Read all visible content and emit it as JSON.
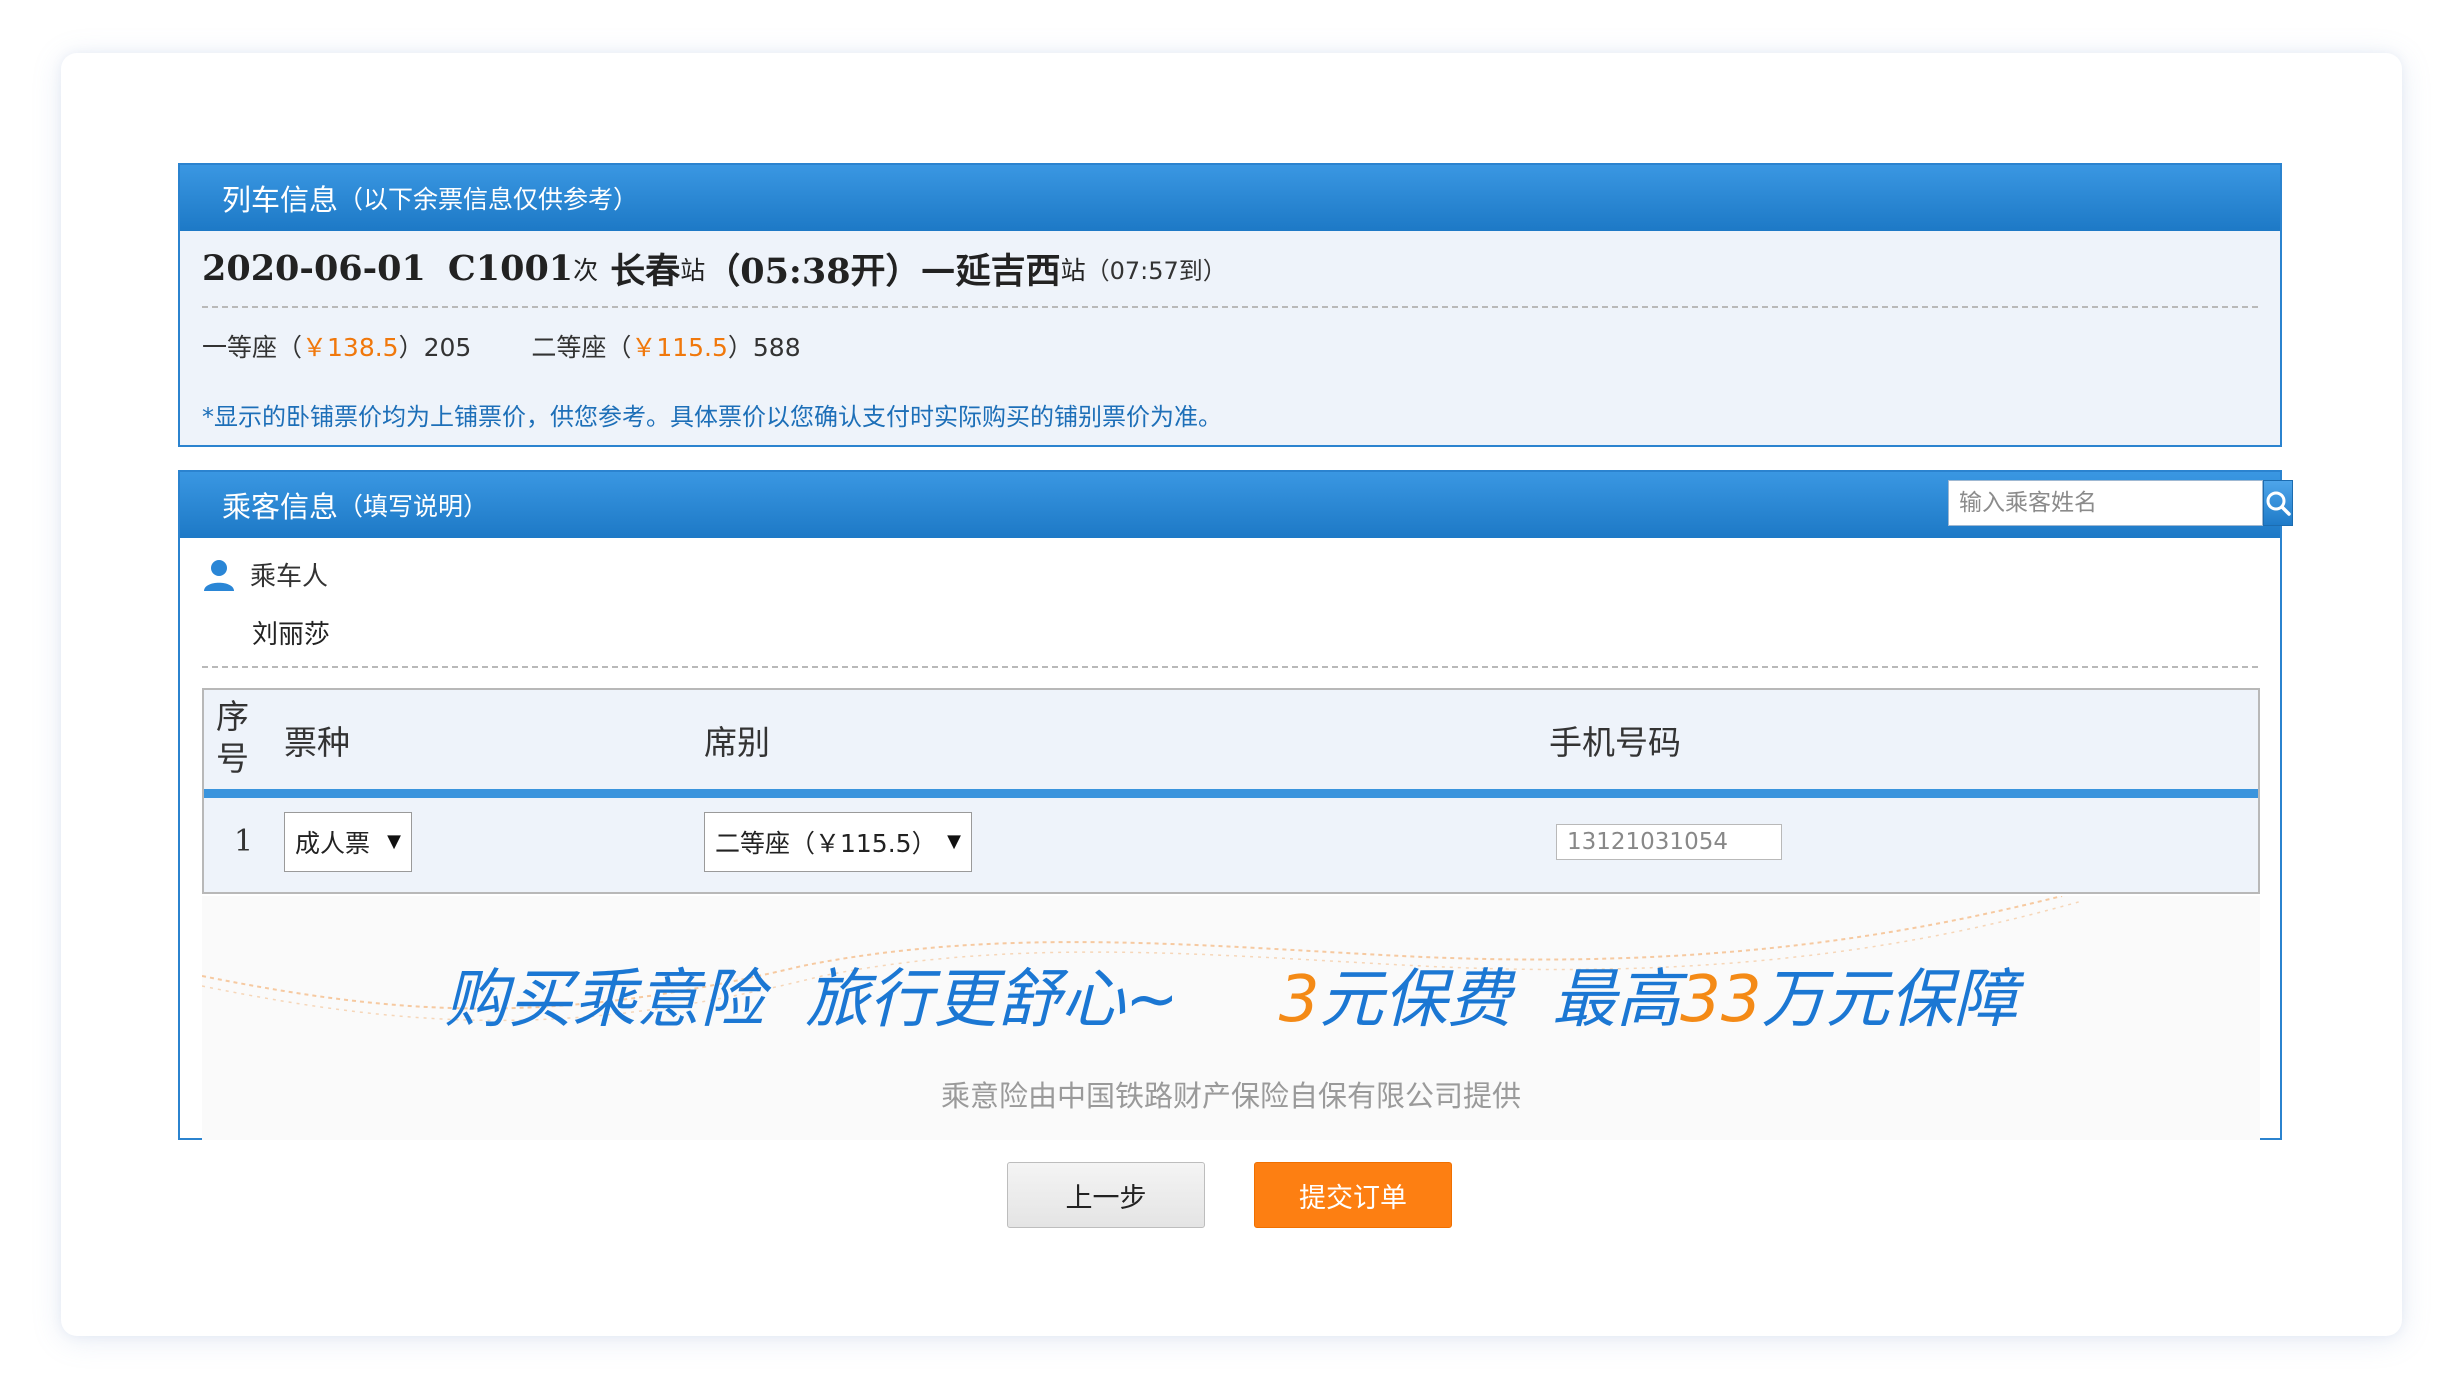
{
  "train_panel": {
    "title": "列车信息",
    "subtitle": "（以下余票信息仅供参考）",
    "date": "2020-06-01",
    "train_no": "C1001",
    "train_suffix": "次",
    "from_station": "长春",
    "station_suffix": "站",
    "depart_time": "（05:38开）",
    "dash": "—",
    "to_station": "延吉西",
    "arrive_time": "（07:57到）",
    "seats": [
      {
        "name": "一等座（",
        "price": "￥138.5",
        "rest": "）205"
      },
      {
        "name": "二等座（",
        "price": "￥115.5",
        "rest": "）588"
      }
    ],
    "note": "*显示的卧铺票价均为上铺票价，供您参考。具体票价以您确认支付时实际购买的铺别票价为准。"
  },
  "passenger_panel": {
    "title": "乘客信息",
    "subtitle": "（填写说明）",
    "search_placeholder": "输入乘客姓名",
    "riders_label": "乘车人",
    "rider_name": "刘丽莎",
    "table": {
      "headers": {
        "index": "序号",
        "ticket_type": "票种",
        "seat_class": "席别",
        "phone": "手机号码"
      },
      "rows": [
        {
          "index": "1",
          "ticket_type": "成人票",
          "seat_class": "二等座（￥115.5）",
          "phone": "13121031054"
        }
      ]
    },
    "insurance": {
      "slogan_a": "购买乘意险  旅行更舒心~",
      "slogan_num1": "3",
      "slogan_b": "元保费  最高",
      "slogan_num2": "33",
      "slogan_c": "万元保障",
      "provider": "乘意险由中国铁路财产保险自保有限公司提供"
    }
  },
  "buttons": {
    "prev": "上一步",
    "submit": "提交订单"
  },
  "colors": {
    "header_blue": "#2b83cf",
    "price_orange": "#f0780c",
    "submit_orange": "#fd7f12",
    "note_blue": "#1d6fb8"
  }
}
